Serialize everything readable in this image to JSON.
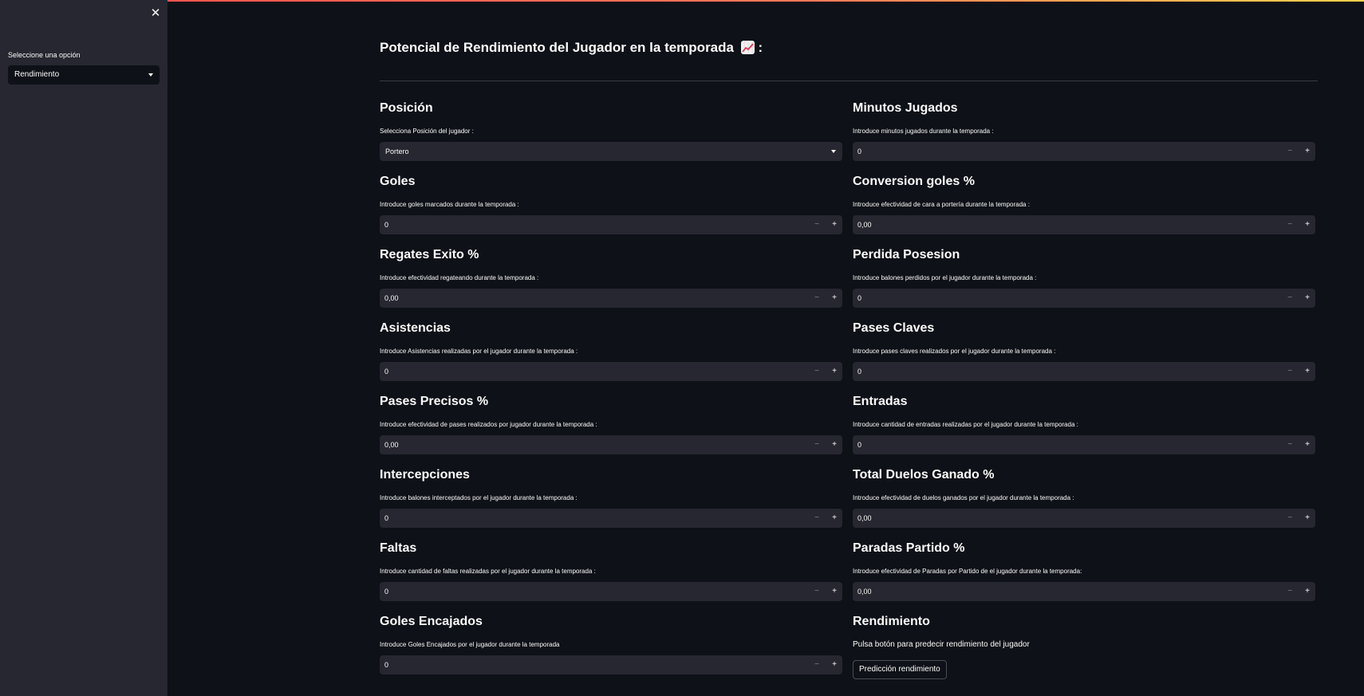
{
  "sidebar": {
    "close_icon": "close-icon",
    "select_label": "Seleccione una opción",
    "select_value": "Rendimiento"
  },
  "header": {
    "title": "Potencial de Rendimiento del Jugador en la temporada",
    "title_suffix": ":",
    "emoji_icon": "chart-increasing-icon"
  },
  "left": {
    "posicion": {
      "title": "Posición",
      "help": "Selecciona Posición del jugador :",
      "value": "Portero"
    },
    "goles": {
      "title": "Goles",
      "help": "Introduce goles marcados durante la temporada :",
      "value": "0"
    },
    "regates": {
      "title": "Regates Exito %",
      "help": "Introduce efectividad regateando durante la temporada :",
      "value": "0,00"
    },
    "asistencias": {
      "title": "Asistencias",
      "help": "Introduce Asistencias realizadas por el jugador durante la temporada :",
      "value": "0"
    },
    "pases_precisos": {
      "title": "Pases Precisos %",
      "help": "Introduce efectividad de pases realizados por jugador durante la temporada :",
      "value": "0,00"
    },
    "intercepciones": {
      "title": "Intercepciones",
      "help": "Introduce balones interceptados por el jugador durante la temporada :",
      "value": "0"
    },
    "faltas": {
      "title": "Faltas",
      "help": "Introduce cantidad de faltas realizadas por el jugador durante la temporada :",
      "value": "0"
    },
    "goles_encajados": {
      "title": "Goles Encajados",
      "help": "Introduce Goles Encajados por el jugador durante la temporada",
      "value": "0"
    }
  },
  "right": {
    "minutos": {
      "title": "Minutos Jugados",
      "help": "Introduce minutos jugados durante la temporada :",
      "value": "0"
    },
    "conversion": {
      "title": "Conversion goles %",
      "help": "Introduce efectividad de cara a portería durante la temporada :",
      "value": "0,00"
    },
    "perdida": {
      "title": "Perdida Posesion",
      "help": "Introduce balones perdidos por el jugador durante la temporada :",
      "value": "0"
    },
    "pases_claves": {
      "title": "Pases Claves",
      "help": "Introduce pases claves realizados por el jugador durante la temporada :",
      "value": "0"
    },
    "entradas": {
      "title": "Entradas",
      "help": "Introduce cantidad de entradas realizadas por el jugador durante la temporada :",
      "value": "0"
    },
    "duelos": {
      "title": "Total Duelos Ganado %",
      "help": "Introduce efectividad de duelos ganados por el jugador durante la temporada :",
      "value": "0,00"
    },
    "paradas": {
      "title": "Paradas Partido %",
      "help": "Introduce efectividad de Paradas por Partido de el jugador durante la temporada:",
      "value": "0,00"
    },
    "rendimiento": {
      "title": "Rendimiento",
      "help": "Pulsa botón para predecir rendimiento del jugador",
      "button_label": "Predicción rendimiento"
    }
  },
  "stepper": {
    "minus": "−",
    "plus": "+"
  },
  "colors": {
    "background": "#0e1117",
    "sidebar": "#262730",
    "input": "#262730",
    "accent": "#ff4b4b"
  }
}
